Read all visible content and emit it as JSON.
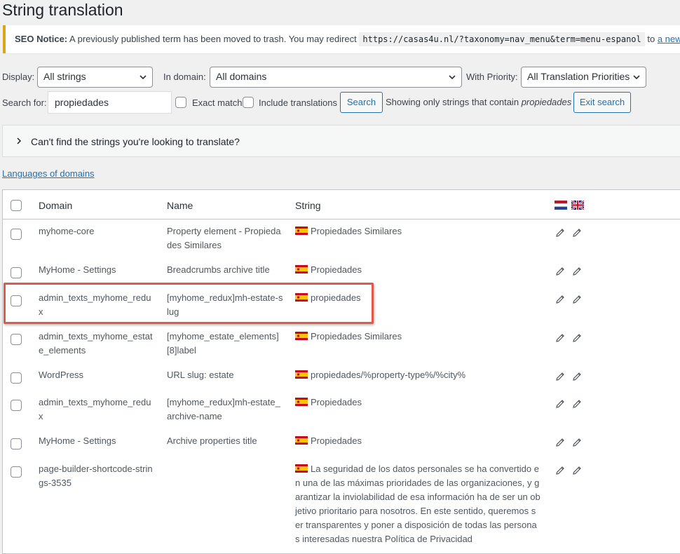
{
  "page_title": "String translation",
  "notice": {
    "label": "SEO Notice:",
    "text": "A previously published term has been moved to trash. You may redirect",
    "code": "https://casas4u.nl/?taxonomy=nav_menu&term=menu-espanol",
    "to": "to",
    "link": "a new"
  },
  "filters": {
    "display_label": "Display:",
    "display_value": "All strings",
    "domain_label": "In domain:",
    "domain_value": "All domains",
    "priority_label": "With Priority:",
    "priority_value": "All Translation Priorities",
    "search_label": "Search for:",
    "search_value": "propiedades",
    "exact_match": "Exact match",
    "include_translations": "Include translations",
    "search_button": "Search",
    "showing_prefix": "Showing only strings that contain",
    "showing_term": "propiedades",
    "exit_button": "Exit search"
  },
  "help": "Can't find the strings you're looking to translate?",
  "languages_link": "Languages of domains",
  "table": {
    "headers": {
      "domain": "Domain",
      "name": "Name",
      "string": "String"
    },
    "rows": [
      {
        "domain": "myhome-core",
        "name": "Property element - Propiedades Similares",
        "string": "Propiedades Similares"
      },
      {
        "domain": "MyHome - Settings",
        "name": "Breadcrumbs archive title",
        "string": "Propiedades"
      },
      {
        "domain": "admin_texts_myhome_redux",
        "name": "[myhome_redux]mh-estate-slug",
        "string": "propiedades"
      },
      {
        "domain": "admin_texts_myhome_estate_elements",
        "name": "[myhome_estate_elements][8]label",
        "string": "Propiedades Similares"
      },
      {
        "domain": "WordPress",
        "name": "URL slug: estate",
        "string": "propiedades/%property-type%/%city%"
      },
      {
        "domain": "admin_texts_myhome_redux",
        "name": "[myhome_redux]mh-estate_archive-name",
        "string": "Propiedades"
      },
      {
        "domain": "MyHome - Settings",
        "name": "Archive properties title",
        "string": "Propiedades"
      },
      {
        "domain": "page-builder-shortcode-strings-3535",
        "name": "",
        "string": "La seguridad de los datos personales se ha convertido en una de las máximas prioridades de las organizaciones, y garantizar la inviolabilidad de esa información ha de ser un objetivo prioritario para nosotros. En este sentido, queremos ser transparentes y poner a disposición de todas las personas interesadas nuestra Política de Privacidad"
      }
    ]
  },
  "colors": {
    "accent": "#2271b1",
    "highlight": "#e05a47",
    "notice": "#dba617"
  },
  "icons": [
    "chevron-down-icon",
    "chevron-right-icon",
    "flag-nl-icon",
    "flag-gb-icon",
    "flag-es-icon",
    "pencil-icon"
  ]
}
